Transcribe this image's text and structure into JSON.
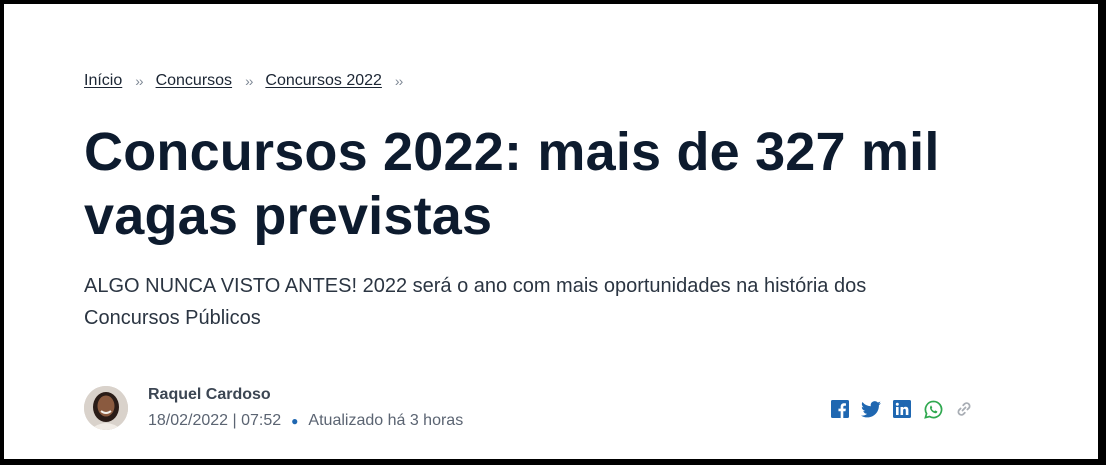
{
  "breadcrumb": {
    "items": [
      "Início",
      "Concursos",
      "Concursos 2022"
    ],
    "separator": "››"
  },
  "article": {
    "title": "Concursos 2022: mais de 327 mil vagas previstas",
    "subtitle": "ALGO NUNCA VISTO ANTES! 2022 será o ano com mais oportunidades na história dos Concursos Públicos"
  },
  "author": {
    "name": "Raquel Cardoso",
    "date": "18/02/2022 | 07:52",
    "updated": "Atualizado há 3 horas"
  },
  "share": {
    "icons": [
      "facebook-icon",
      "twitter-icon",
      "linkedin-icon",
      "whatsapp-icon",
      "link-icon"
    ],
    "colors": {
      "facebook": "#1f67b1",
      "twitter": "#1f67b1",
      "linkedin": "#1f67b1",
      "whatsapp": "#2fa84f",
      "link": "#a8adb4"
    }
  }
}
